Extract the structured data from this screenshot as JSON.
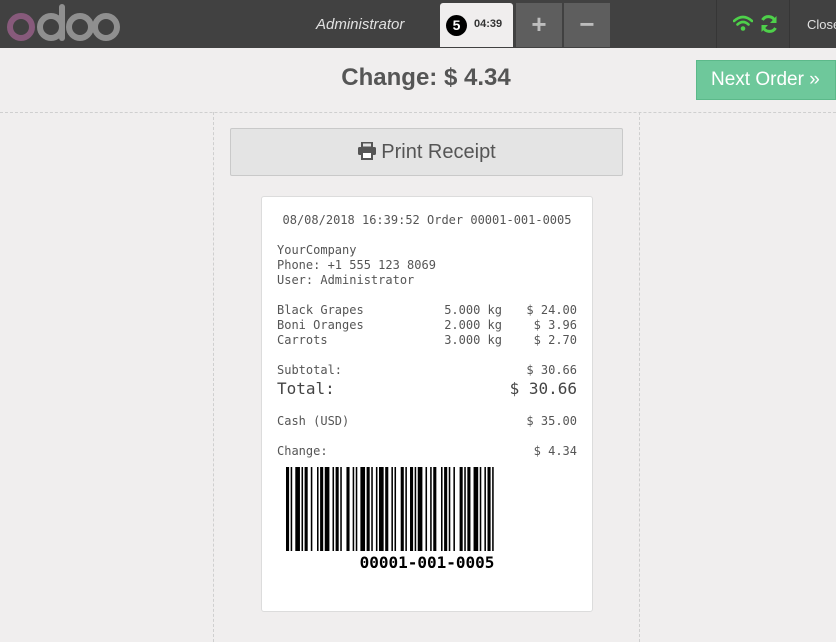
{
  "header": {
    "logo_text": "odoo",
    "user": "Administrator",
    "order_number": "5",
    "order_time": "04:39",
    "add_label": "+",
    "remove_label": "−",
    "close_label": "Close",
    "wifi_icon": "wifi-icon",
    "sync_icon": "sync-icon",
    "colors": {
      "logo_o": "#875a7b",
      "logo_text": "#8f8f8f",
      "status": "#4ed14a"
    }
  },
  "payment": {
    "change_text": "Change: $ 4.34",
    "next_order_label": "Next Order »",
    "print_label": "Print Receipt",
    "print_icon": "printer-icon",
    "accent": "#6ec89b"
  },
  "receipt": {
    "header_line": "08/08/2018 16:39:52 Order 00001-001-0005",
    "company": "YourCompany",
    "phone": "Phone: +1 555 123 8069",
    "user": "User: Administrator",
    "lines": [
      {
        "name": "Black Grapes",
        "qty": "5.000 kg",
        "price": "$ 24.00"
      },
      {
        "name": "Boni Oranges",
        "qty": "2.000 kg",
        "price": "$ 3.96"
      },
      {
        "name": "Carrots",
        "qty": "3.000 kg",
        "price": "$ 2.70"
      }
    ],
    "subtotal_label": "Subtotal:",
    "subtotal_value": "$ 30.66",
    "total_label": "Total:",
    "total_value": "$ 30.66",
    "payment_label": "Cash (USD)",
    "payment_value": "$ 35.00",
    "change_label": "Change:",
    "change_value": "$ 4.34",
    "barcode_text": "00001-001-0005"
  }
}
